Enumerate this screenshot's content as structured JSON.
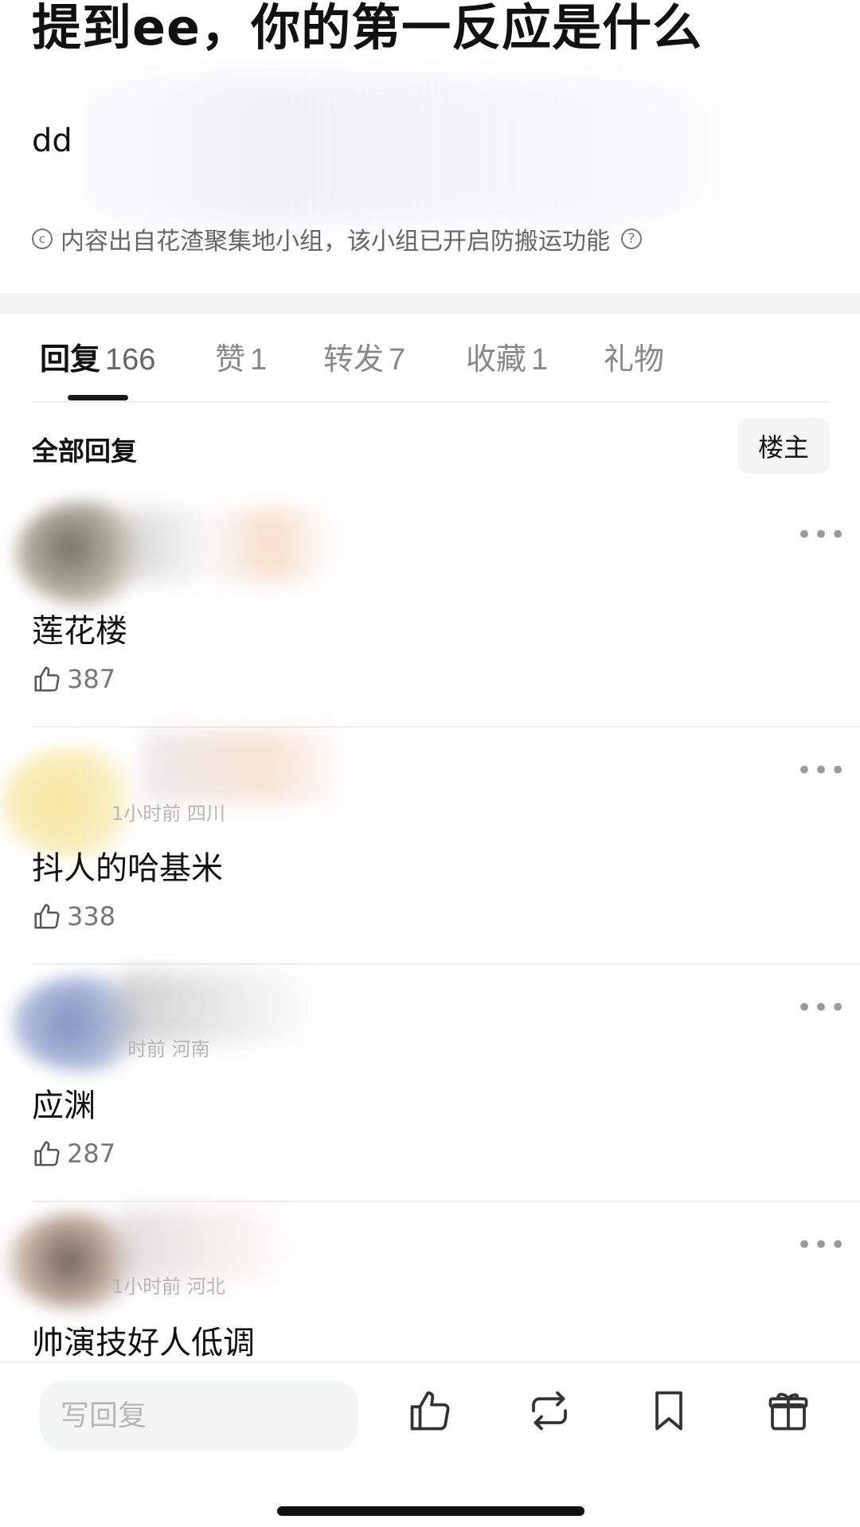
{
  "post": {
    "title": "提到ee，你的第一反应是什么",
    "body": "dd",
    "notice": "内容出自花渣聚集地小组，该小组已开启防搬运功能",
    "notice_icon": "copyright-icon",
    "help_icon": "question-circle-icon"
  },
  "tabs": [
    {
      "label": "回复",
      "count": "166",
      "active": true
    },
    {
      "label": "赞",
      "count": "1",
      "active": false
    },
    {
      "label": "转发",
      "count": "7",
      "active": false
    },
    {
      "label": "收藏",
      "count": "1",
      "active": false
    },
    {
      "label": "礼物",
      "count": "",
      "active": false
    }
  ],
  "section": {
    "title": "全部回复",
    "op_filter": "楼主"
  },
  "comments": [
    {
      "meta": "",
      "text": "莲花楼",
      "likes": "387"
    },
    {
      "meta": "1小时前 四川",
      "text": "抖人的哈基米",
      "likes": "338"
    },
    {
      "meta": "时前 河南",
      "text": "应渊",
      "likes": "287"
    },
    {
      "meta": "1小时前 河北",
      "text": "帅演技好人低调",
      "likes": ""
    }
  ],
  "more_label": "•••",
  "bottom_bar": {
    "reply_placeholder": "写回复",
    "icons": [
      "thumbs-up-icon",
      "repost-icon",
      "bookmark-icon",
      "gift-icon"
    ]
  },
  "colors": {
    "text": "#111111",
    "muted": "#777777",
    "divider": "#eeeeee",
    "input_bg": "#f2f6f4"
  }
}
